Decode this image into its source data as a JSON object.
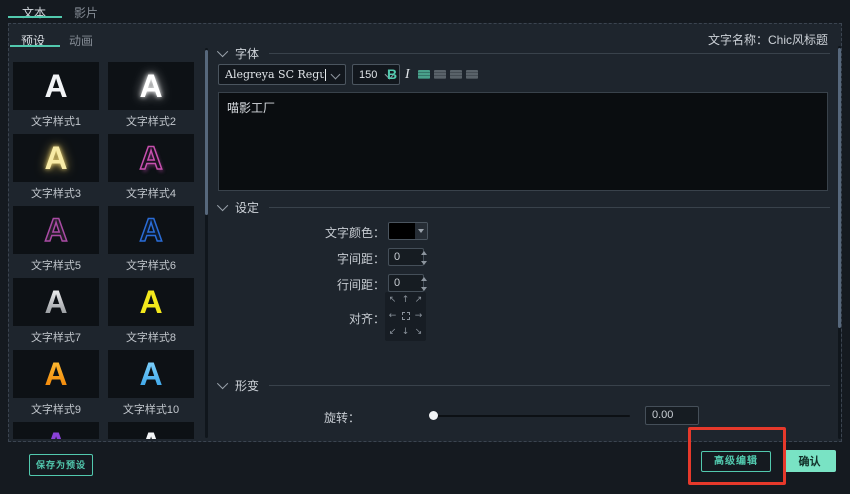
{
  "colors": {
    "accent": "#52c9ae",
    "confirm_bg": "#79e3c4",
    "annotation_red": "#e6392b",
    "swatch_color": "#000000"
  },
  "topbar": {
    "tabs": [
      {
        "label": "文本",
        "active": true
      },
      {
        "label": "影片",
        "active": false
      }
    ]
  },
  "subtabs": [
    {
      "label": "预设",
      "active": true
    },
    {
      "label": "动画",
      "active": false
    }
  ],
  "header": {
    "text_name": "文字名称：Chic风标题"
  },
  "presets": {
    "items": [
      {
        "label": "文字样式1",
        "letter": "A",
        "style": "white"
      },
      {
        "label": "文字样式2",
        "letter": "A",
        "style": "white-glow"
      },
      {
        "label": "文字样式3",
        "letter": "A",
        "style": "gold-glow"
      },
      {
        "label": "文字样式4",
        "letter": "A",
        "style": "pink-outline"
      },
      {
        "label": "文字样式5",
        "letter": "A",
        "style": "magenta-outline"
      },
      {
        "label": "文字样式6",
        "letter": "A",
        "style": "blue-outline"
      },
      {
        "label": "文字样式7",
        "letter": "A",
        "style": "silver"
      },
      {
        "label": "文字样式8",
        "letter": "A",
        "style": "yellow"
      },
      {
        "label": "文字样式9",
        "letter": "A",
        "style": "orange-gradient"
      },
      {
        "label": "文字样式10",
        "letter": "A",
        "style": "blue-gradient"
      }
    ],
    "partial_items": [
      {
        "letter": "A",
        "style": "purple"
      },
      {
        "letter": "A",
        "style": "white"
      }
    ]
  },
  "font_section": {
    "title": "字体",
    "font_family_value": "Alegreya SC Regular",
    "font_size_value": "150",
    "bold_label": "B",
    "italic_label": "I"
  },
  "text_input": {
    "value": "喵影工厂"
  },
  "settings_section": {
    "title": "设定",
    "color_label": "文字颜色：",
    "letter_spacing_label": "字间距：",
    "letter_spacing_value": "0",
    "line_spacing_label": "行间距：",
    "line_spacing_value": "0",
    "align_label": "对齐：",
    "align_arrows": [
      "↖",
      "↑",
      "↗",
      "←",
      "",
      "→",
      "↙",
      "↓",
      "↘"
    ]
  },
  "transform_section": {
    "title": "形变",
    "rotate_label": "旋转：",
    "rotate_value": "0.00"
  },
  "footer": {
    "save_preset_label": "保存为预设",
    "advanced_edit_label": "高级编辑",
    "confirm_label": "确认"
  }
}
